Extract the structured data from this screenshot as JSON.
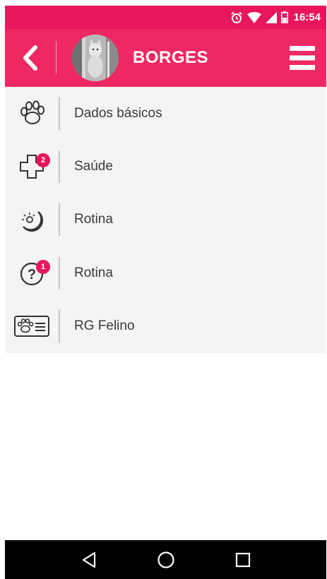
{
  "status_bar": {
    "time": "16:54",
    "icons": [
      "alarm-icon",
      "wifi-icon",
      "signal-icon",
      "battery-icon"
    ]
  },
  "app_bar": {
    "title": "BORGES",
    "back_icon": "chevron-left-icon",
    "menu_icon": "hamburger-menu-icon"
  },
  "menu": {
    "items": [
      {
        "label": "Dados básicos",
        "icon": "paw-icon"
      },
      {
        "label": "Saúde",
        "icon": "health-cross-icon",
        "badge": "2"
      },
      {
        "label": "Rotina",
        "icon": "sun-moon-icon"
      },
      {
        "label": "Rotina",
        "icon": "question-icon",
        "badge": "1"
      },
      {
        "label": "RG Felino",
        "icon": "id-card-icon"
      }
    ]
  },
  "nav_bar": {
    "buttons": [
      "back-triangle-icon",
      "home-circle-icon",
      "recents-square-icon"
    ]
  },
  "colors": {
    "primary": "#ee2863",
    "status": "#e8175d",
    "list_bg": "#f4f4f4",
    "text": "#3a3a3a",
    "badge": "#e8175d"
  }
}
